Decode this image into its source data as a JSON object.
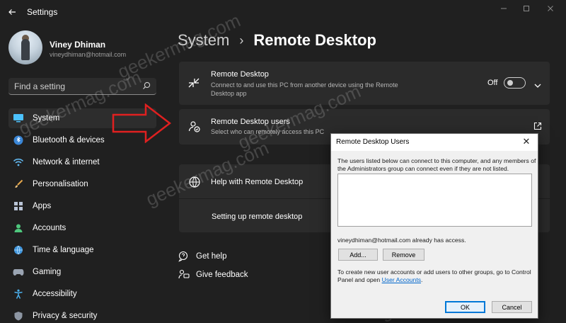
{
  "window": {
    "title": "Settings"
  },
  "user": {
    "name": "Viney Dhiman",
    "email": "vineydhiman@hotmail.com"
  },
  "search": {
    "placeholder": "Find a setting"
  },
  "nav": {
    "items": [
      {
        "label": "System",
        "icon": "system-icon",
        "active": true
      },
      {
        "label": "Bluetooth & devices",
        "icon": "bluetooth-icon"
      },
      {
        "label": "Network & internet",
        "icon": "wifi-icon"
      },
      {
        "label": "Personalisation",
        "icon": "brush-icon"
      },
      {
        "label": "Apps",
        "icon": "apps-icon"
      },
      {
        "label": "Accounts",
        "icon": "accounts-icon"
      },
      {
        "label": "Time & language",
        "icon": "globe-clock-icon"
      },
      {
        "label": "Gaming",
        "icon": "gamepad-icon"
      },
      {
        "label": "Accessibility",
        "icon": "accessibility-icon"
      },
      {
        "label": "Privacy & security",
        "icon": "shield-icon"
      }
    ]
  },
  "breadcrumb": {
    "parent": "System",
    "current": "Remote Desktop"
  },
  "remote_desktop": {
    "title": "Remote Desktop",
    "subtitle_line1": "Connect to and use this PC from another device using the Remote",
    "subtitle_line2": "Desktop app",
    "toggle_state": "Off",
    "enabled": false
  },
  "remote_users": {
    "title": "Remote Desktop users",
    "subtitle": "Select who can remotely access this PC"
  },
  "help": {
    "title": "Help with Remote Desktop",
    "item": "Setting up remote desktop"
  },
  "links": {
    "get_help": "Get help",
    "give_feedback": "Give feedback"
  },
  "watermark": "geekermag.com",
  "dialog": {
    "title": "Remote Desktop Users",
    "intro_line1": "The users listed below can connect to this computer, and any members of",
    "intro_line2": "the Administrators group can connect even if they are not listed.",
    "access_note": "vineydhiman@hotmail.com already has access.",
    "add_label": "Add...",
    "remove_label": "Remove",
    "footer_line1": "To create new user accounts or add users to other groups, go to Control",
    "footer_line2_prefix": "Panel and open ",
    "footer_link": "User Accounts",
    "footer_line2_suffix": ".",
    "ok_label": "OK",
    "cancel_label": "Cancel"
  },
  "colors": {
    "accent": "#4cc2ff",
    "background": "#202020",
    "card": "#2b2b2b",
    "arrow": "#e02020"
  }
}
